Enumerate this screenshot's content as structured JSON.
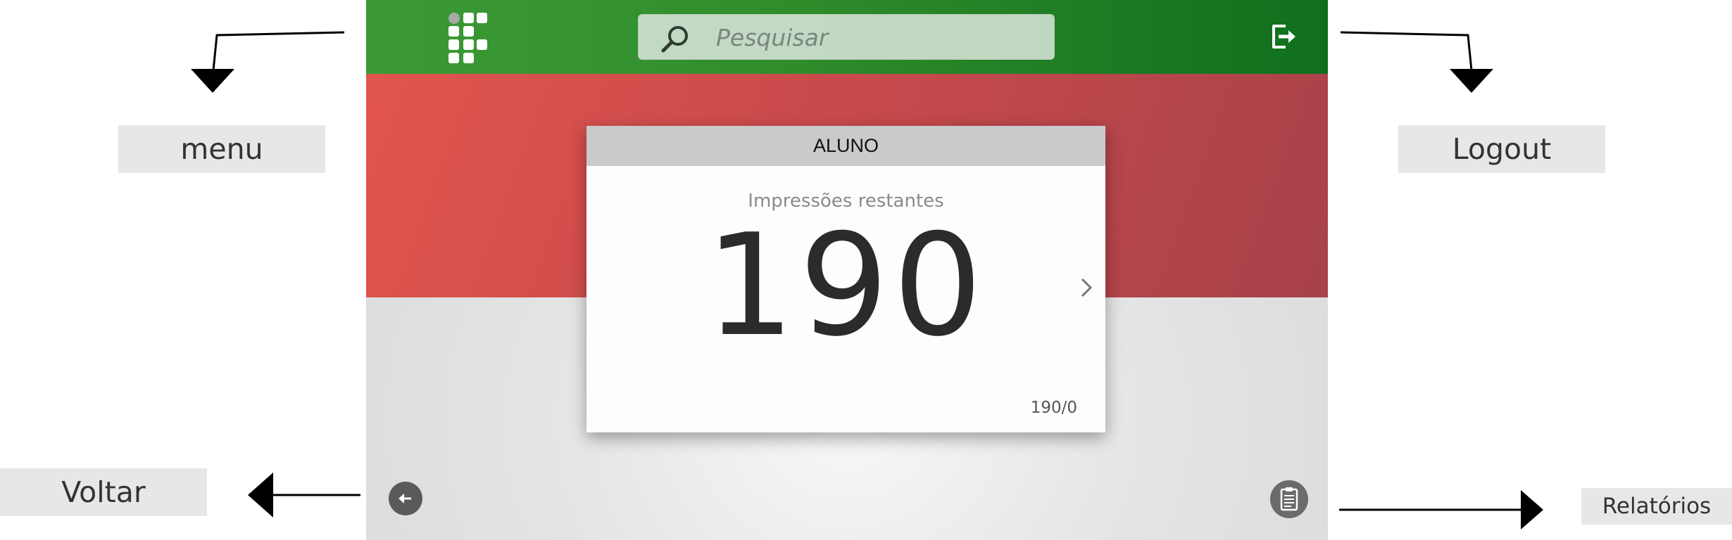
{
  "annotations": {
    "menu": "menu",
    "logout": "Logout",
    "voltar": "Voltar",
    "relatorios": "Relatórios"
  },
  "topbar": {
    "search_placeholder": "Pesquisar",
    "logo_icon": "grid-logo-icon",
    "logout_icon": "logout-icon"
  },
  "card": {
    "header": "ALUNO",
    "subtitle": "Impressões restantes",
    "value": "190",
    "footer": "190/0"
  },
  "bottom": {
    "back_icon": "arrow-left-icon",
    "report_icon": "clipboard-icon"
  },
  "colors": {
    "topbar_start": "#3c9a36",
    "topbar_end": "#0f6f1d",
    "hero_start": "#e1554d",
    "hero_end": "#a7424a"
  }
}
